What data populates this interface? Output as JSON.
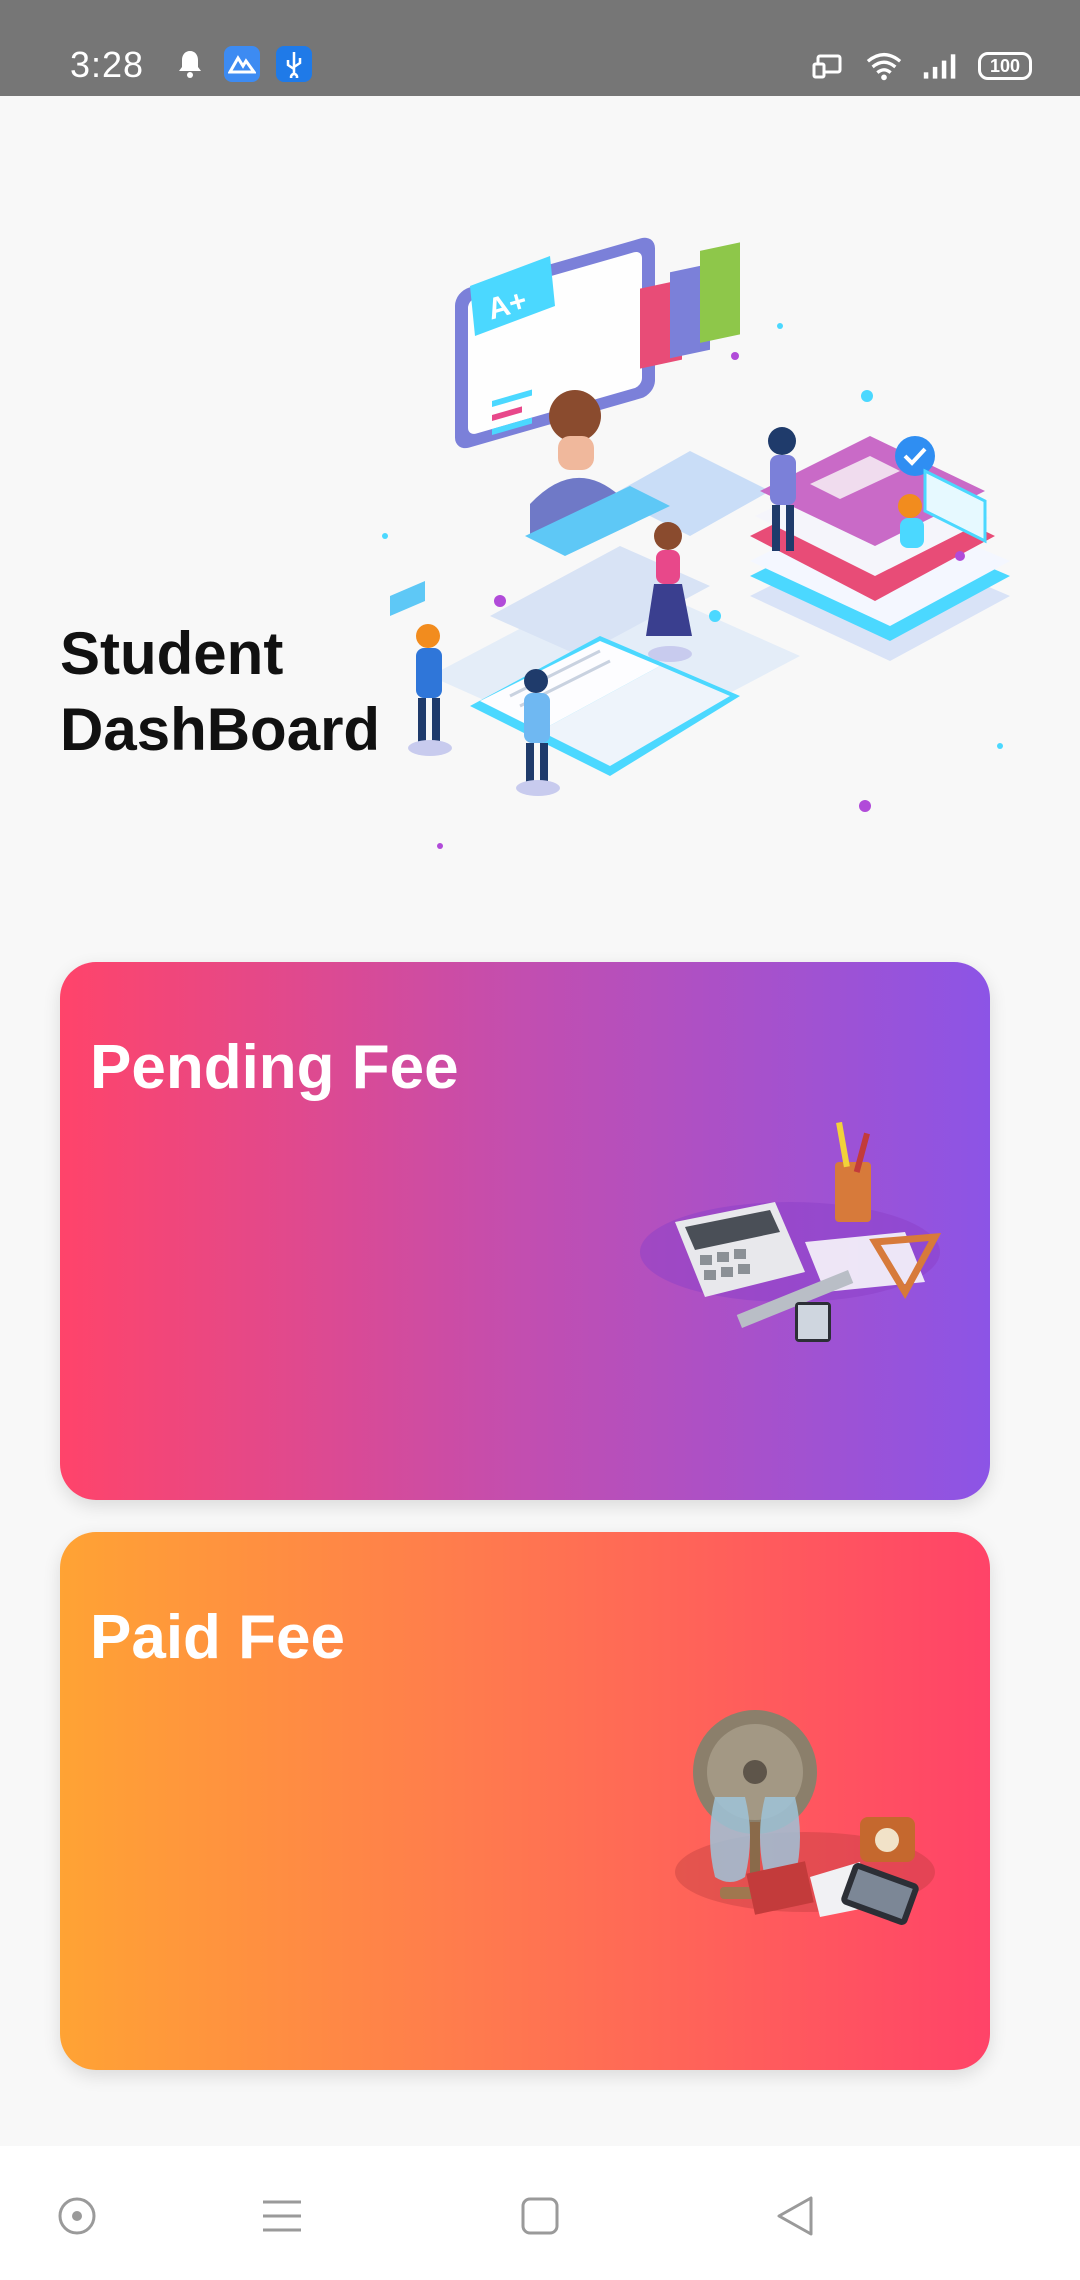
{
  "status_bar": {
    "time": "3:28",
    "battery": "100",
    "icons": [
      "bell-icon",
      "app-icon",
      "usb-icon",
      "cast-icon",
      "wifi-icon",
      "signal-icon",
      "battery-icon"
    ]
  },
  "page": {
    "title_line1": "Student",
    "title_line2": "DashBoard"
  },
  "cards": {
    "pending": {
      "label": "Pending Fee",
      "gradient": [
        "#ff446a",
        "#c24eb0",
        "#8c54e6"
      ]
    },
    "paid": {
      "label": "Paid Fee",
      "gradient": [
        "#ffa334",
        "#ff7a4e",
        "#ff4368"
      ]
    }
  },
  "navbar": {
    "buttons": [
      "assistant-button",
      "menu-button",
      "home-button",
      "back-button"
    ]
  }
}
